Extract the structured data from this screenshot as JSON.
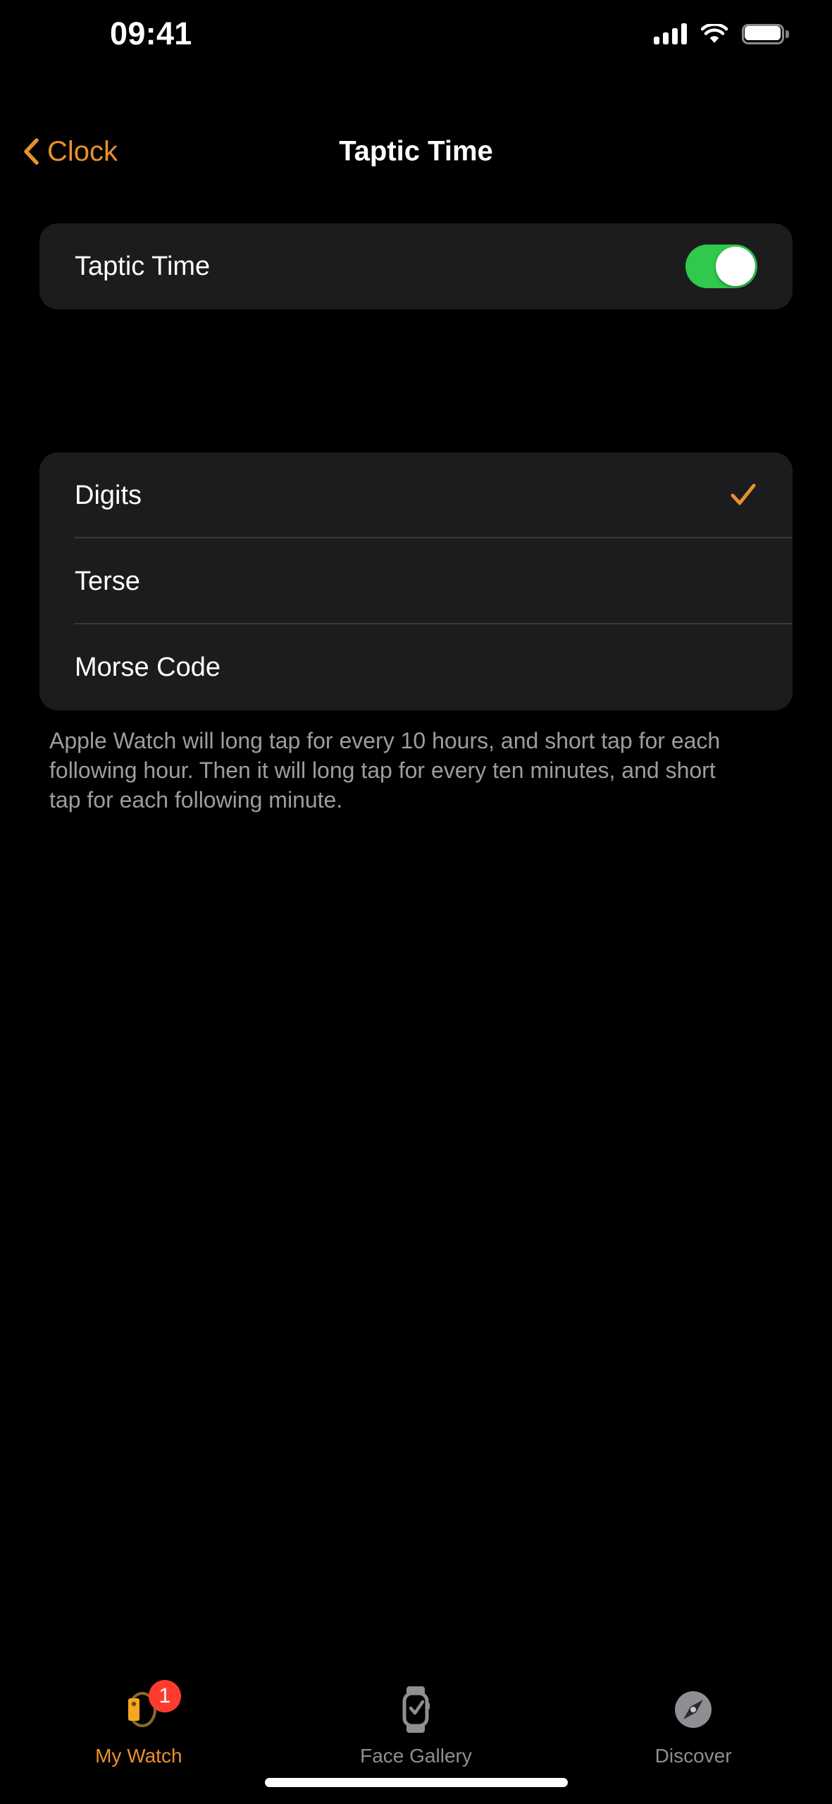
{
  "status_bar": {
    "time": "09:41",
    "cellular_icon": "cellular-signal-icon",
    "wifi_icon": "wifi-icon",
    "battery_icon": "battery-full-icon"
  },
  "nav_bar": {
    "back_icon": "chevron-left-icon",
    "back_label": "Clock",
    "title": "Taptic Time"
  },
  "toggle_section": {
    "label": "Taptic Time",
    "state": "on",
    "on_color": "#30C94B"
  },
  "options_section": {
    "selected": "Digits",
    "check_icon": "checkmark-icon",
    "check_color": "#E8912B",
    "items": [
      {
        "label": "Digits",
        "selected": true
      },
      {
        "label": "Terse",
        "selected": false
      },
      {
        "label": "Morse Code",
        "selected": false
      }
    ]
  },
  "footer": {
    "note": "Apple Watch will long tap for every 10 hours, and short tap for each following hour. Then it will long tap for every ten minutes, and short tap for each following minute."
  },
  "tab_bar": {
    "active_color": "#E8912B",
    "inactive_color": "#8E8E93",
    "tabs": [
      {
        "label": "My Watch",
        "icon": "watch-side-icon",
        "active": true,
        "badge": "1"
      },
      {
        "label": "Face Gallery",
        "icon": "watch-face-icon",
        "active": false
      },
      {
        "label": "Discover",
        "icon": "compass-icon",
        "active": false
      }
    ]
  }
}
